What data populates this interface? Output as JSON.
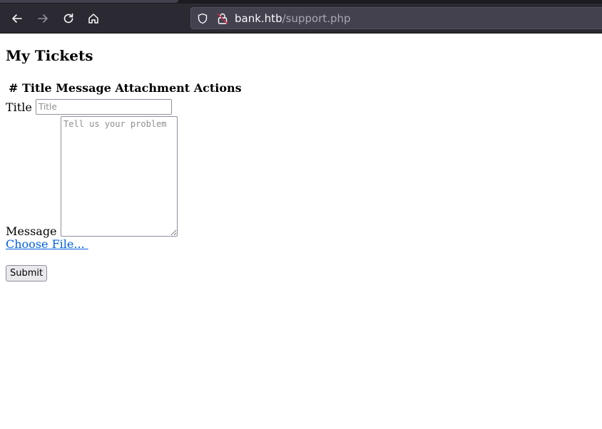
{
  "browser": {
    "url_host": "bank.htb",
    "url_path": "/support.php",
    "icons": [
      "back-arrow-icon",
      "forward-arrow-icon",
      "reload-icon",
      "home-icon",
      "shield-icon",
      "lock-insecure-icon"
    ]
  },
  "page": {
    "heading": "My Tickets",
    "table_header": "# Title Message Attachment Actions",
    "form": {
      "title_label": "Title",
      "title_placeholder": "Title",
      "message_label": "Message",
      "message_placeholder": "Tell us your problem",
      "file_label": "Choose File... ",
      "submit_label": "Submit"
    }
  },
  "colors": {
    "chrome_bg": "#2b2a33",
    "urlbar_bg": "#42414d",
    "link": "#0060df",
    "insecure": "#e22850"
  }
}
